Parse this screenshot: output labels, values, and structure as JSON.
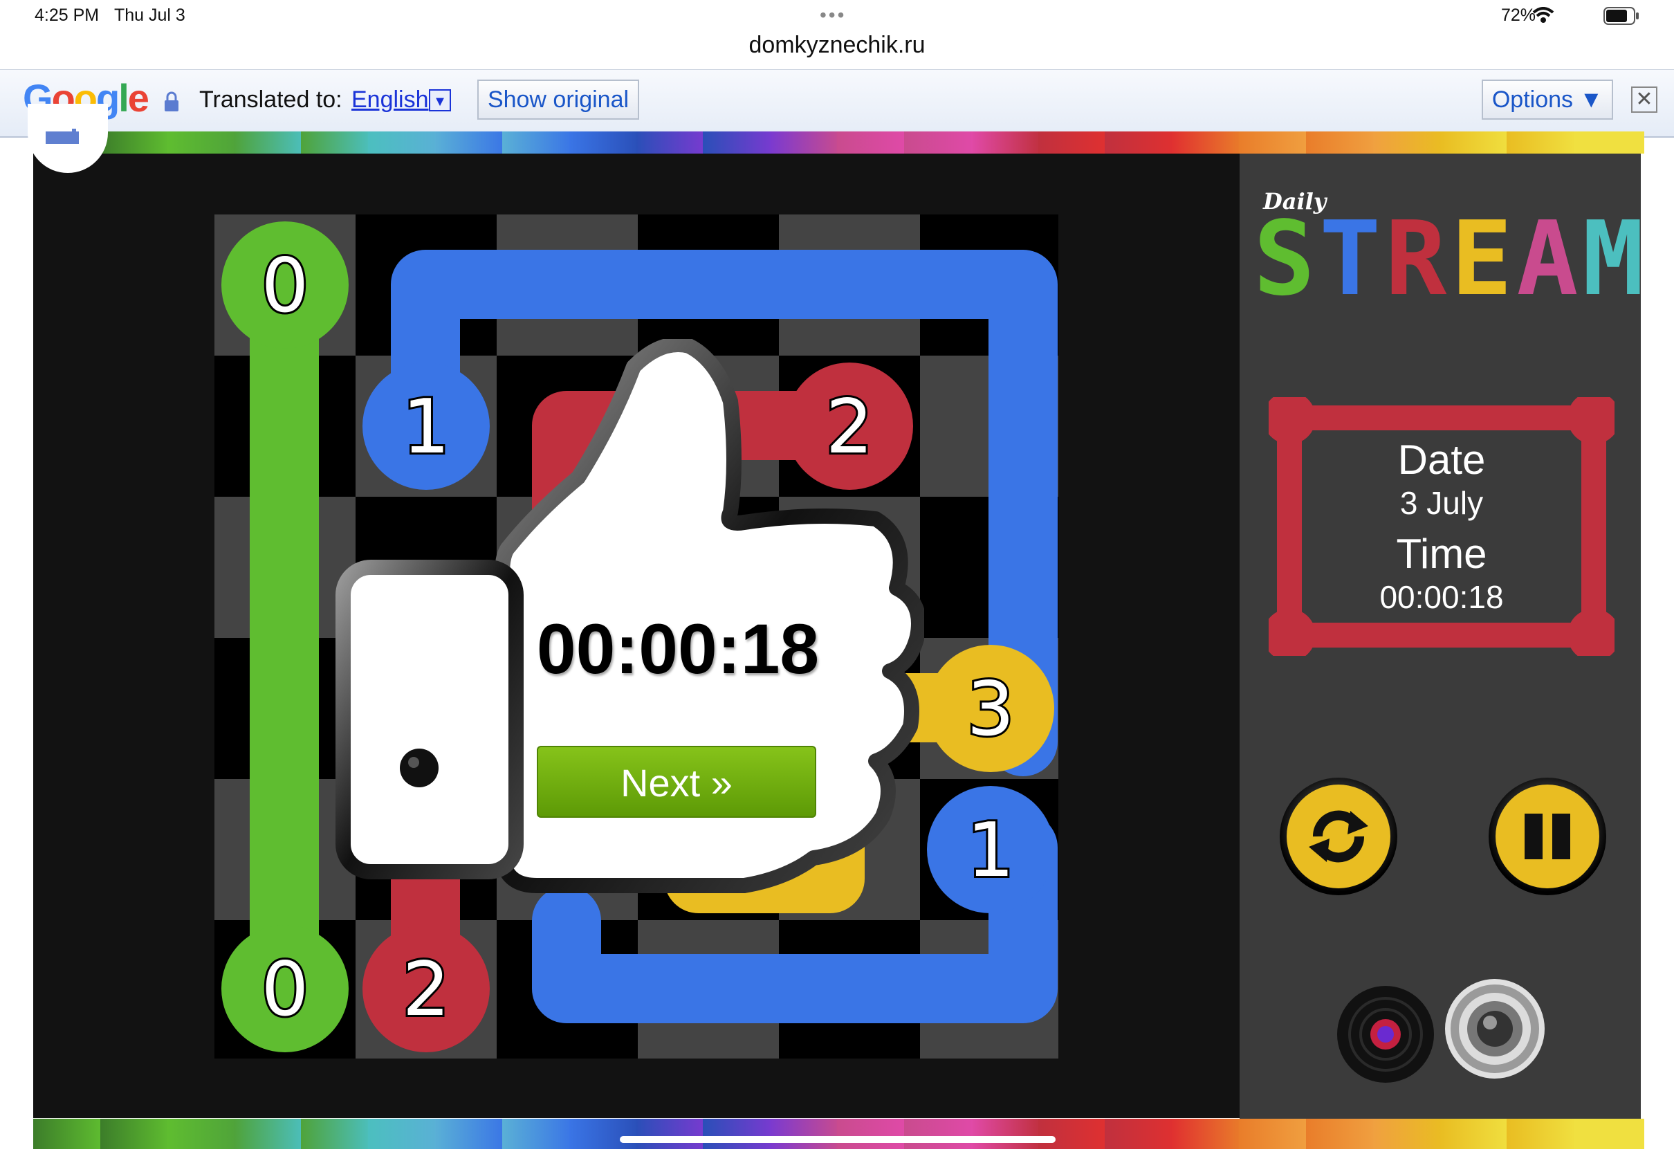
{
  "status_bar": {
    "time": "4:25 PM",
    "date": "Thu Jul 3",
    "battery": "72%"
  },
  "browser": {
    "url": "domkyznechik.ru"
  },
  "translate_bar": {
    "logo": "Google",
    "translated_to_label": "Translated to:",
    "language": "English",
    "show_original": "Show original",
    "options": "Options ▼",
    "close": "✕"
  },
  "game": {
    "title_small": "Daily",
    "title": "STREAM",
    "date_label": "Date",
    "date_value": "3 July",
    "time_label": "Time",
    "time_value": "00:00:18",
    "overlay_time": "00:00:18",
    "next_button": "Next »",
    "colors": {
      "green": "#5fbd30",
      "blue": "#3a75e6",
      "red": "#c0303e",
      "yellow": "#e9bd22",
      "pink": "#c94b8e",
      "teal": "#4cbfbf"
    },
    "endpoints": [
      {
        "label": "0",
        "color": "green",
        "row": 0,
        "col": 0
      },
      {
        "label": "0",
        "color": "green",
        "row": 6,
        "col": 0
      },
      {
        "label": "1",
        "color": "blue",
        "row": 1,
        "col": 1
      },
      {
        "label": "1",
        "color": "blue",
        "row": 4,
        "col": 5
      },
      {
        "label": "2",
        "color": "red",
        "row": 1,
        "col": 4
      },
      {
        "label": "2",
        "color": "red",
        "row": 6,
        "col": 1
      },
      {
        "label": "3",
        "color": "yellow",
        "row": 3,
        "col": 5
      }
    ]
  }
}
